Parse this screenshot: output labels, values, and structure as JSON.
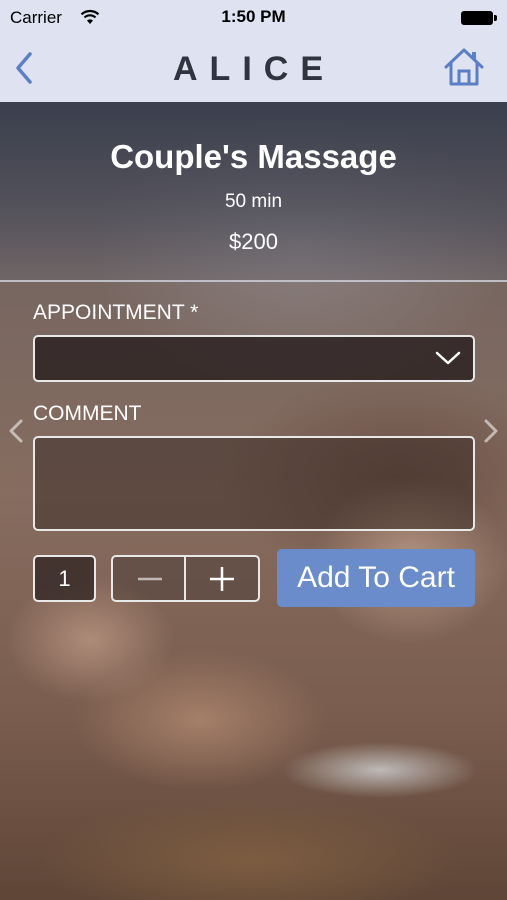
{
  "status_bar": {
    "carrier": "Carrier",
    "time": "1:50 PM"
  },
  "nav": {
    "logo_text": "ALICE",
    "back_icon": "chevron-left-icon",
    "home_icon": "home-icon",
    "accent_color": "#5b7fc4"
  },
  "product": {
    "title": "Couple's Massage",
    "duration": "50 min",
    "price": "$200"
  },
  "form": {
    "appointment_label": "APPOINTMENT *",
    "appointment_value": "",
    "comment_label": "COMMENT",
    "comment_value": "",
    "quantity": "1",
    "minus_symbol": "−",
    "plus_symbol": "+",
    "add_to_cart_label": "Add To Cart",
    "add_to_cart_color": "#6b8ccb"
  }
}
